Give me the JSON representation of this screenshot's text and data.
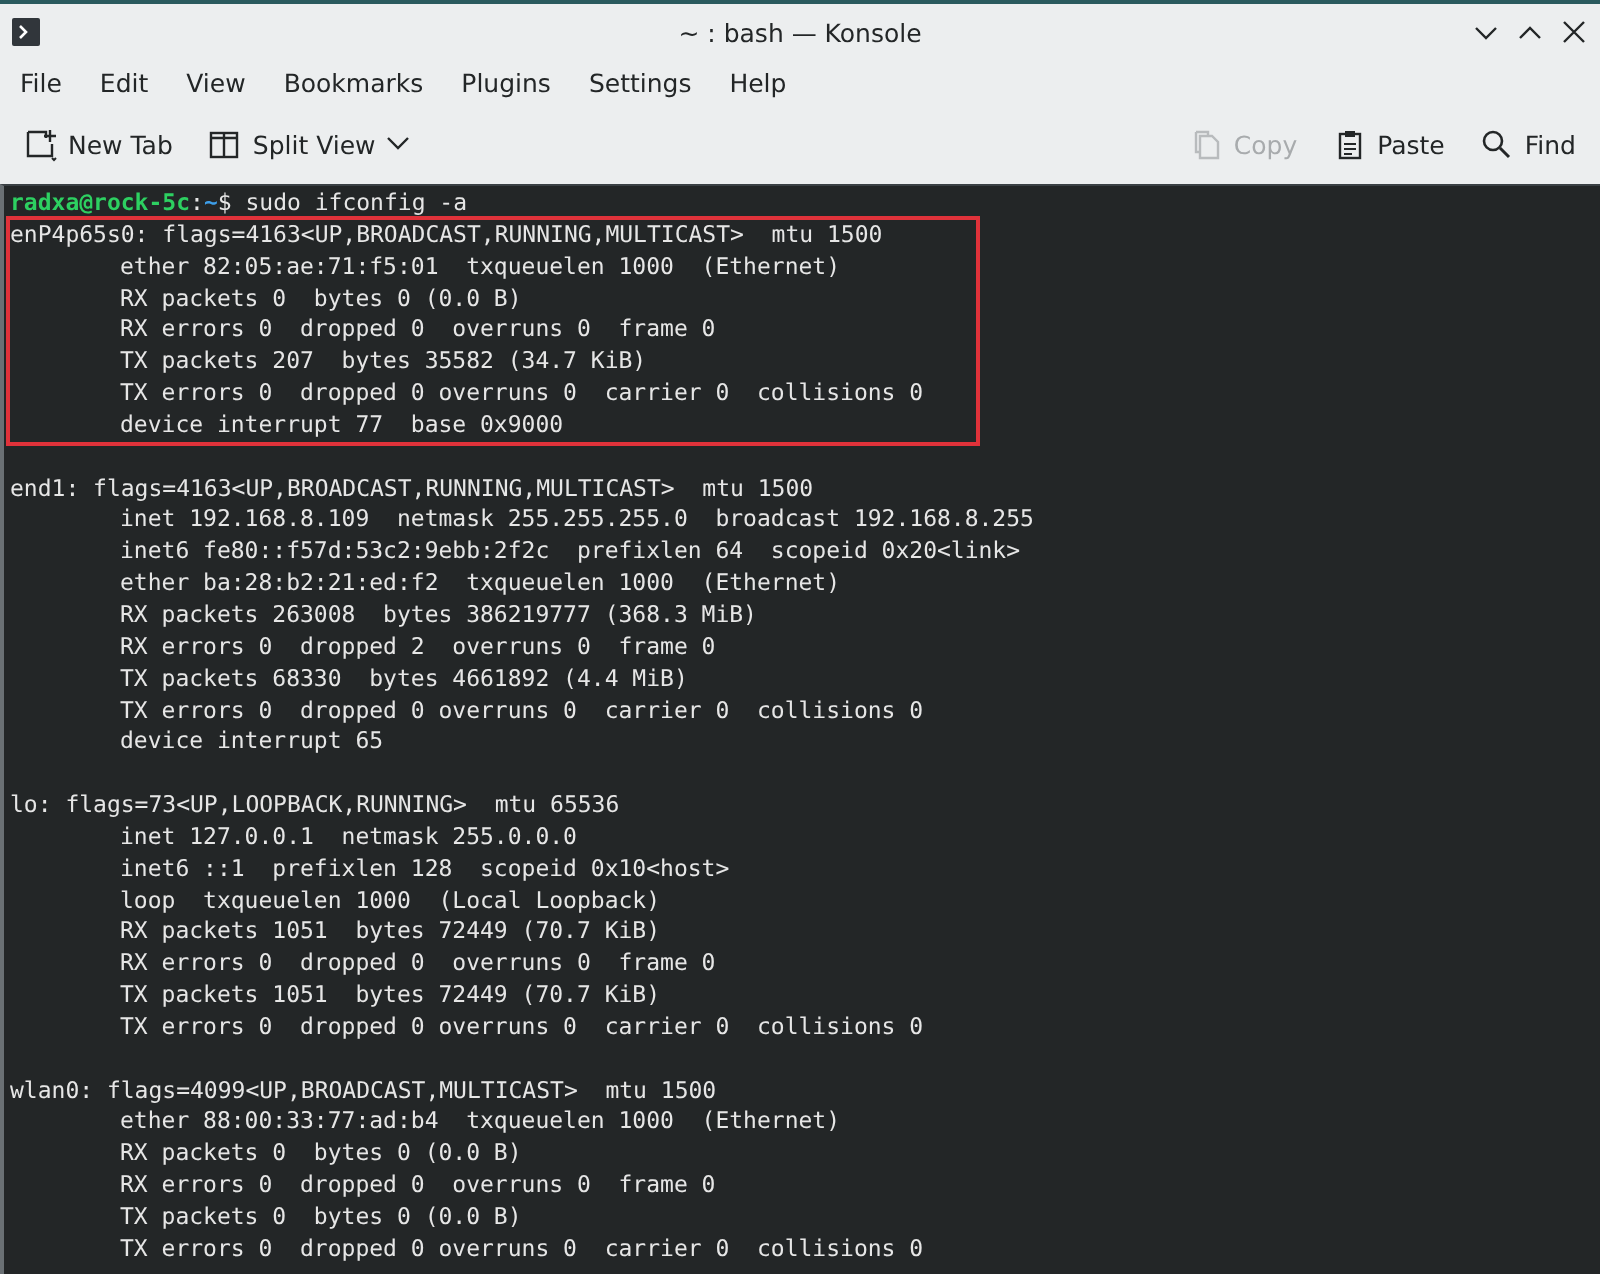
{
  "window": {
    "title": "~ : bash — Konsole"
  },
  "menu": [
    "File",
    "Edit",
    "View",
    "Bookmarks",
    "Plugins",
    "Settings",
    "Help"
  ],
  "toolbar": [
    {
      "kind": "newtab",
      "label": "New Tab",
      "disabled": false
    },
    {
      "kind": "split",
      "label": "Split View",
      "disabled": false
    },
    {
      "kind": "spacer"
    },
    {
      "kind": "copy",
      "label": "Copy",
      "disabled": true
    },
    {
      "kind": "paste",
      "label": "Paste",
      "disabled": false
    },
    {
      "kind": "find",
      "label": "Find",
      "disabled": false
    }
  ],
  "terminal": {
    "prompt": {
      "user_host": "radxa@rock-5c",
      "separator": ":",
      "path": "~",
      "symbol": "$",
      "command": "sudo ifconfig -a"
    },
    "blocks": [
      {
        "highlighted": true,
        "header": "enP4p65s0: flags=4163<UP,BROADCAST,RUNNING,MULTICAST>  mtu 1500",
        "lines": [
          "ether 82:05:ae:71:f5:01  txqueuelen 1000  (Ethernet)",
          "RX packets 0  bytes 0 (0.0 B)",
          "RX errors 0  dropped 0  overruns 0  frame 0",
          "TX packets 207  bytes 35582 (34.7 KiB)",
          "TX errors 0  dropped 0 overruns 0  carrier 0  collisions 0",
          "device interrupt 77  base 0x9000"
        ]
      },
      {
        "highlighted": false,
        "header": "end1: flags=4163<UP,BROADCAST,RUNNING,MULTICAST>  mtu 1500",
        "lines": [
          "inet 192.168.8.109  netmask 255.255.255.0  broadcast 192.168.8.255",
          "inet6 fe80::f57d:53c2:9ebb:2f2c  prefixlen 64  scopeid 0x20<link>",
          "ether ba:28:b2:21:ed:f2  txqueuelen 1000  (Ethernet)",
          "RX packets 263008  bytes 386219777 (368.3 MiB)",
          "RX errors 0  dropped 2  overruns 0  frame 0",
          "TX packets 68330  bytes 4661892 (4.4 MiB)",
          "TX errors 0  dropped 0 overruns 0  carrier 0  collisions 0",
          "device interrupt 65"
        ]
      },
      {
        "highlighted": false,
        "header": "lo: flags=73<UP,LOOPBACK,RUNNING>  mtu 65536",
        "lines": [
          "inet 127.0.0.1  netmask 255.0.0.0",
          "inet6 ::1  prefixlen 128  scopeid 0x10<host>",
          "loop  txqueuelen 1000  (Local Loopback)",
          "RX packets 1051  bytes 72449 (70.7 KiB)",
          "RX errors 0  dropped 0  overruns 0  frame 0",
          "TX packets 1051  bytes 72449 (70.7 KiB)",
          "TX errors 0  dropped 0 overruns 0  carrier 0  collisions 0"
        ]
      },
      {
        "highlighted": false,
        "header": "wlan0: flags=4099<UP,BROADCAST,MULTICAST>  mtu 1500",
        "lines": [
          "ether 88:00:33:77:ad:b4  txqueuelen 1000  (Ethernet)",
          "RX packets 0  bytes 0 (0.0 B)",
          "RX errors 0  dropped 0  overruns 0  frame 0",
          "TX packets 0  bytes 0 (0.0 B)",
          "TX errors 0  dropped 0 overruns 0  carrier 0  collisions 0"
        ]
      }
    ]
  }
}
